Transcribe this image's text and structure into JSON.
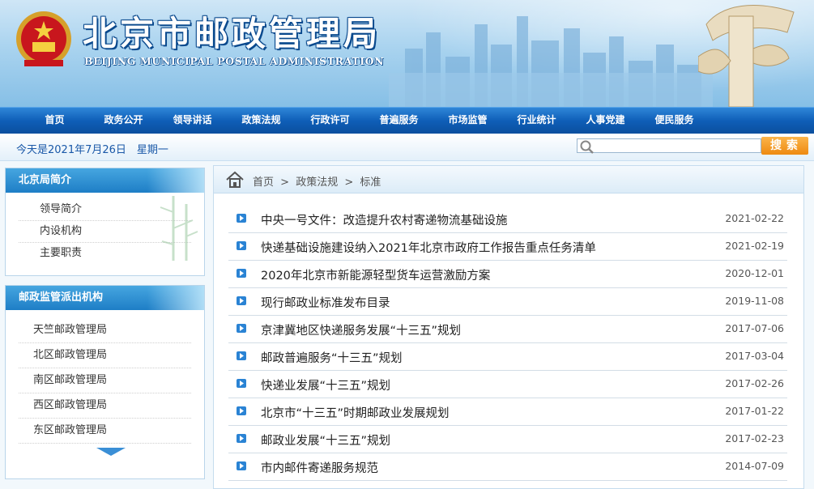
{
  "header": {
    "title": "北京市邮政管理局",
    "subtitle": "BEIJING MUNICIPAL POSTAL ADMINISTRATION"
  },
  "nav": {
    "items": [
      "首页",
      "政务公开",
      "领导讲话",
      "政策法规",
      "行政许可",
      "普遍服务",
      "市场监管",
      "行业统计",
      "人事党建",
      "便民服务"
    ]
  },
  "infobar": {
    "date": "今天是2021年7月26日　星期一",
    "search_button": "搜索"
  },
  "sidebar": {
    "intro": {
      "heading": "北京局简介",
      "items": [
        "领导简介",
        "内设机构",
        "主要职责"
      ]
    },
    "branches": {
      "heading": "邮政监管派出机构",
      "items": [
        "天竺邮政管理局",
        "北区邮政管理局",
        "南区邮政管理局",
        "西区邮政管理局",
        "东区邮政管理局"
      ]
    }
  },
  "breadcrumb": {
    "items": [
      "首页",
      ">",
      "政策法规",
      ">",
      "标准"
    ]
  },
  "news": [
    {
      "title": "中央一号文件：改造提升农村寄递物流基础设施",
      "date": "2021-02-22"
    },
    {
      "title": "快递基础设施建设纳入2021年北京市政府工作报告重点任务清单",
      "date": "2021-02-19"
    },
    {
      "title": "2020年北京市新能源轻型货车运营激励方案",
      "date": "2020-12-01"
    },
    {
      "title": "现行邮政业标准发布目录",
      "date": "2019-11-08"
    },
    {
      "title": "京津冀地区快递服务发展“十三五”规划",
      "date": "2017-07-06"
    },
    {
      "title": "邮政普遍服务“十三五”规划",
      "date": "2017-03-04"
    },
    {
      "title": "快递业发展“十三五”规划",
      "date": "2017-02-26"
    },
    {
      "title": "北京市“十三五”时期邮政业发展规划",
      "date": "2017-01-22"
    },
    {
      "title": "邮政业发展“十三五”规划",
      "date": "2017-02-23"
    },
    {
      "title": "市内邮件寄递服务规范",
      "date": "2014-07-09"
    }
  ]
}
